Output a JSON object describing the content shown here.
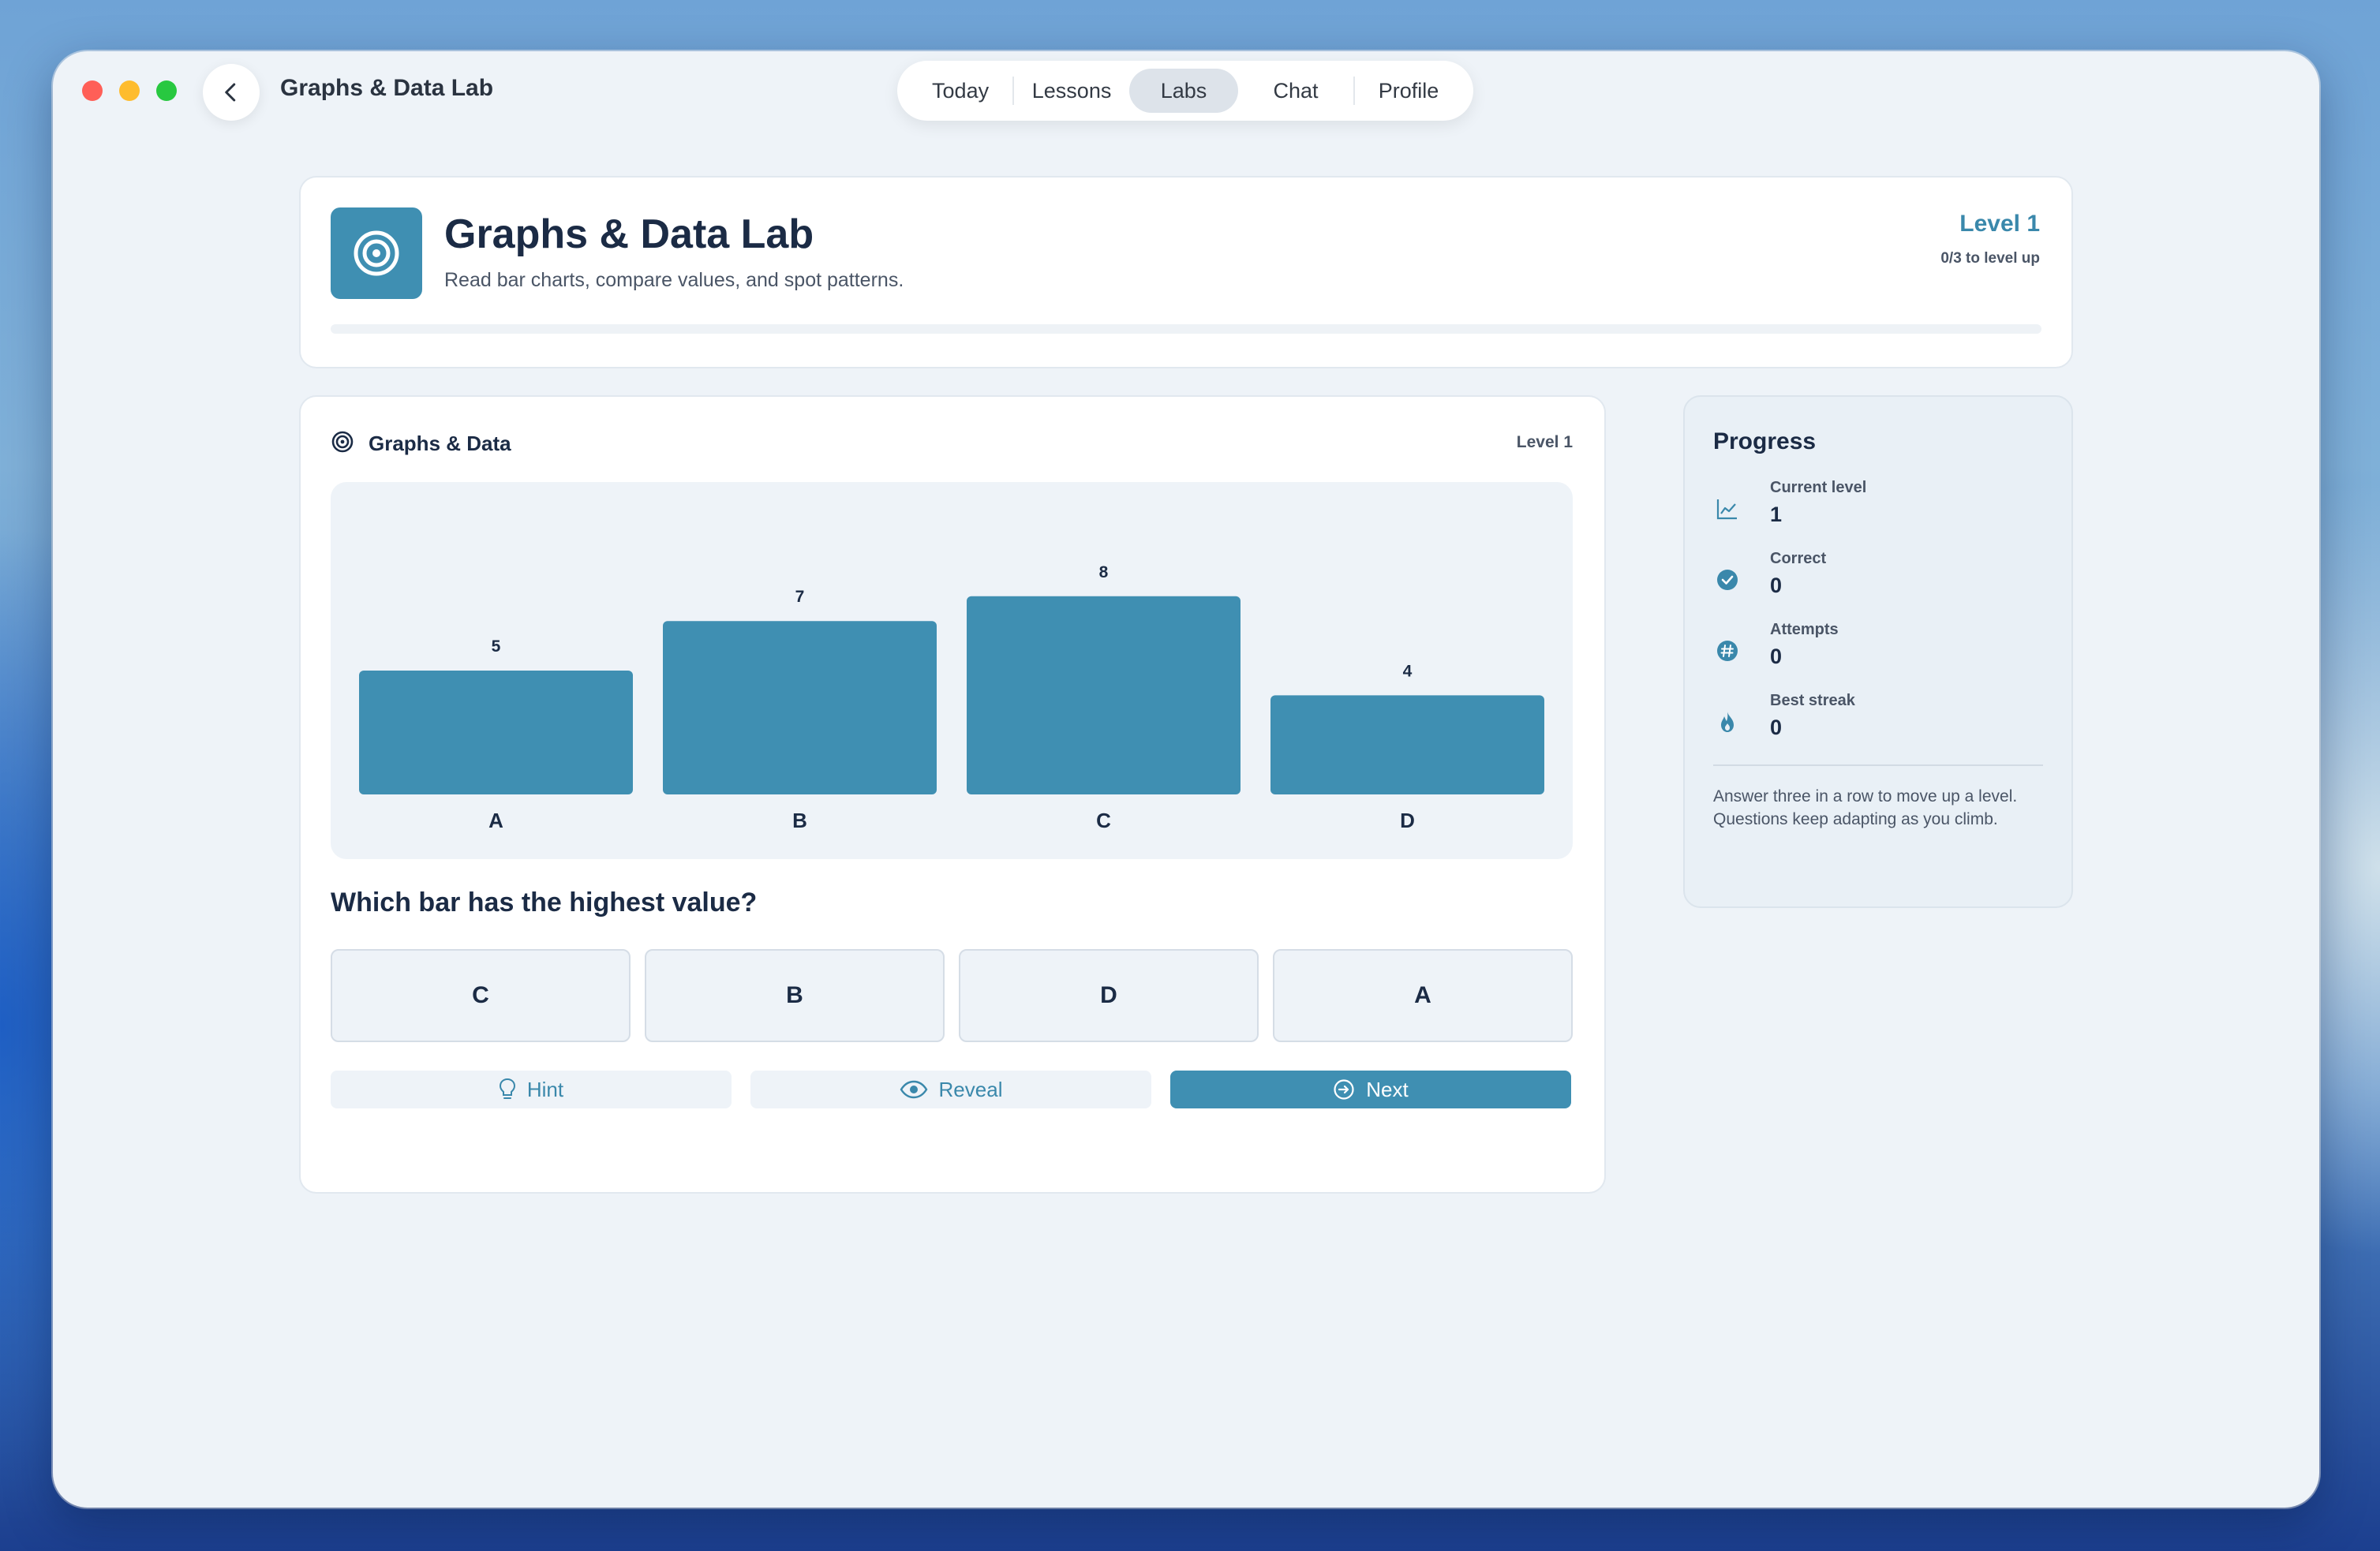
{
  "titlebar": {
    "app_title": "Graphs & Data Lab",
    "nav_tabs": [
      {
        "label": "Today",
        "active": false
      },
      {
        "label": "Lessons",
        "active": false
      },
      {
        "label": "Labs",
        "active": true
      },
      {
        "label": "Chat",
        "active": false
      },
      {
        "label": "Profile",
        "active": false
      }
    ]
  },
  "header": {
    "title": "Graphs & Data Lab",
    "subtitle": "Read bar charts, compare values, and spot patterns.",
    "level": "Level 1",
    "level_progress": "0/3 to level up",
    "progress_fraction": 0,
    "icon": "target-icon"
  },
  "lab": {
    "title": "Graphs & Data",
    "level": "Level 1",
    "question": "Which bar has the highest value?",
    "answers": [
      "C",
      "B",
      "D",
      "A"
    ],
    "actions": {
      "hint": "Hint",
      "reveal": "Reveal",
      "next": "Next"
    }
  },
  "chart_data": {
    "type": "bar",
    "categories": [
      "A",
      "B",
      "C",
      "D"
    ],
    "values": [
      5,
      7,
      8,
      4
    ],
    "ylim": [
      0,
      10
    ],
    "grid": false,
    "bar_color": "#3f8fb2"
  },
  "progress": {
    "title": "Progress",
    "stats": [
      {
        "label": "Current level",
        "value": "1",
        "icon": "trend-chart-icon"
      },
      {
        "label": "Correct",
        "value": "0",
        "icon": "check-circle-icon"
      },
      {
        "label": "Attempts",
        "value": "0",
        "icon": "hash-icon"
      },
      {
        "label": "Best streak",
        "value": "0",
        "icon": "flame-icon"
      }
    ],
    "note": "Answer three in a row to move up a level. Questions keep adapting as you climb."
  },
  "colors": {
    "accent": "#3f8fb2",
    "accent_text": "#3a88ab",
    "heading": "#1b2b45"
  }
}
